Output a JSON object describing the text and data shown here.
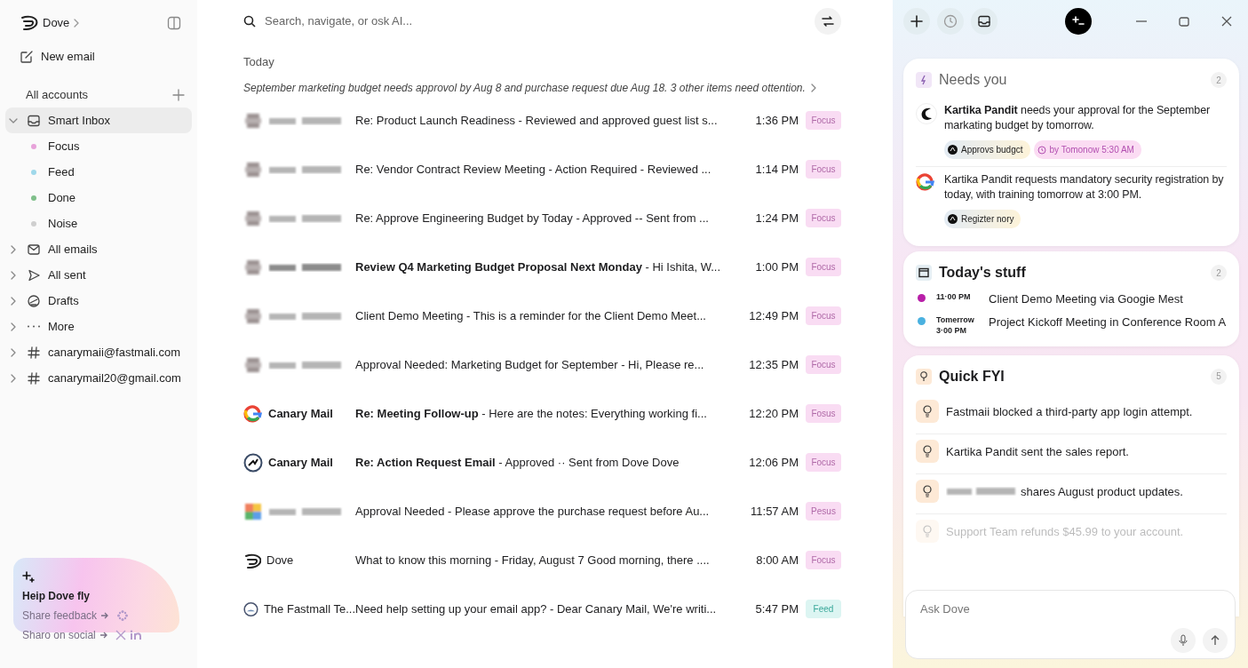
{
  "sidebar": {
    "brand": "Dove",
    "new_email": "New email",
    "accounts_label": "All accounts",
    "folders": [
      {
        "kind": "inbox",
        "label": "Smart Inbox",
        "selected": true,
        "expanded": true,
        "children": [
          {
            "label": "Focus",
            "color": "#e7a3da",
            "selected": false
          },
          {
            "label": "Feed",
            "color": "#9fd8ea",
            "selected": false
          },
          {
            "label": "Done",
            "color": "#7fbf8a",
            "selected": false
          },
          {
            "label": "Noise",
            "color": "#cfcfcf",
            "selected": false
          }
        ]
      },
      {
        "kind": "mail",
        "label": "All emails",
        "selected": false,
        "expanded": false
      },
      {
        "kind": "send",
        "label": "All sent",
        "selected": false,
        "expanded": false
      },
      {
        "kind": "drafts",
        "label": "Drafts",
        "selected": false,
        "expanded": false
      },
      {
        "kind": "more",
        "label": "More",
        "selected": false,
        "expanded": false
      },
      {
        "kind": "hash",
        "label": "canarymaii@fastmali.com",
        "selected": false,
        "expanded": false
      },
      {
        "kind": "hash",
        "label": "canarymail20@gmail.com",
        "selected": false,
        "expanded": false
      }
    ]
  },
  "promo": {
    "title": "Heip Dove fly",
    "links": [
      {
        "label": "Share feedback",
        "kind": "feedback"
      },
      {
        "label": "Sharo on social",
        "kind": "social"
      }
    ]
  },
  "search": {
    "placeholder": "Search, navigate, or osk AI..."
  },
  "section": "Today",
  "summary": "September marketing budget needs approvol by Aug 8 and purchase request due Aug 18. 3 other items need ottention.",
  "emails": [
    {
      "kind": "blurred",
      "unread": false,
      "line": "Re: Product Launch Readiness -  Reviewed and approved guest list s...",
      "time": "1:36 PM",
      "tag": "Focus",
      "color": "#f9dcf3"
    },
    {
      "kind": "blurred",
      "unread": false,
      "line": "Re: Vendor Contract Review Meeting - Action Required -  Reviewed ...",
      "time": "1:14 PM",
      "tag": "Focus",
      "color": "#f9dcf3"
    },
    {
      "kind": "blurred",
      "unread": false,
      "line": "Re: Approve Engineering Budget by Today -  Approved -- Sent from ...",
      "time": "1:24 PM",
      "tag": "Focus",
      "color": "#f9dcf3"
    },
    {
      "kind": "blurred",
      "unread": true,
      "line": "**Review Q4 Marketing Budget Proposal Next Monday** -  Hi Ishita, W...",
      "time": "1:00 PM",
      "tag": "Focus",
      "color": "#f9dcf3"
    },
    {
      "kind": "blurred",
      "unread": false,
      "line": "Client Demo Meeting -  This is a reminder for the Client Demo Meet...",
      "time": "12:49 PM",
      "tag": "Focus",
      "color": "#f9dcf3"
    },
    {
      "kind": "blurred",
      "unread": false,
      "line": "Approval Needed: Marketing Budget for September -  Hi, Please re...",
      "time": "12:35 PM",
      "tag": "Focus",
      "color": "#f9dcf3"
    },
    {
      "kind": "google",
      "sender": "Canary Mail",
      "unread": true,
      "line": "**Re: Meeting Follow-up** -  Here are the notes: Everything working fi...",
      "time": "12:20 PM",
      "tag": "Fosus",
      "color": "#f9dcf3"
    },
    {
      "kind": "canary",
      "sender": "Canary Mail",
      "unread": true,
      "line": "**Re: Action Request Email** -  Approved ·· Sent from Dove Dove",
      "time": "12:06 PM",
      "tag": "Focus",
      "color": "#f9dcf3"
    },
    {
      "kind": "colorful",
      "unread": false,
      "line": "Approval Needed -  Please approve the purchase request before Au...",
      "time": "11:57 AM",
      "tag": "Pesus",
      "color": "#f9dcf3"
    },
    {
      "kind": "dove",
      "sender": "Dove",
      "unread": false,
      "line": "What to know this morning -  Friday, August 7 Good morning, there ....",
      "time": "8:00 AM",
      "tag": "Focus",
      "color": "#f9dcf3"
    },
    {
      "kind": "fastmail",
      "sender": "The Fastmall Te...",
      "unread": false,
      "line": "Need help setting up your email app? -  Dear Canary Mail, We're writi...",
      "time": "5:47 PM",
      "tag": "Feed",
      "color": "#dcf5f2"
    }
  ],
  "needs_you": {
    "title": "Needs you",
    "count": "2",
    "items": [
      {
        "kind": "crescent",
        "text": "**Kartika Pandit** needs your approval for the September markating budget by tomorrow.",
        "chips": [
          {
            "kind": "action",
            "label": "Approvs budgct"
          },
          {
            "kind": "deadline",
            "label": "by Tomonow 5:30 AM"
          }
        ]
      },
      {
        "kind": "google",
        "text": "Kartika Pandit requests mandatory security registration by today, with training tomorrow at 3:00 PM.",
        "chips": [
          {
            "kind": "action",
            "label": "Regizter nory"
          }
        ]
      }
    ]
  },
  "today": {
    "title": "Today's stuff",
    "count": "2",
    "events": [
      {
        "time": "11·00 PM",
        "title": "Client Demo Meeting via Googie Mest",
        "color": "#b81fa8"
      },
      {
        "time": "Tomerrow 3·00 PM",
        "title": "Project Kickoff Meeting in Conference Room A",
        "color": "#4ab1e0"
      }
    ]
  },
  "fyi": {
    "title": "Quick FYI",
    "count": "5",
    "items": [
      {
        "text": "Fastmaii blocked a third-party app login attempt.",
        "blurred_name": false,
        "faded": false
      },
      {
        "text": "Kartika Pandit sent the sales report.",
        "blurred_name": false,
        "faded": false
      },
      {
        "text": "shares August product updates.",
        "blurred_name": true,
        "faded": false
      },
      {
        "text": "Support Team refunds $45.99 to your account.",
        "blurred_name": false,
        "faded": true
      }
    ]
  },
  "ask": {
    "placeholder": "Ask Dove"
  }
}
